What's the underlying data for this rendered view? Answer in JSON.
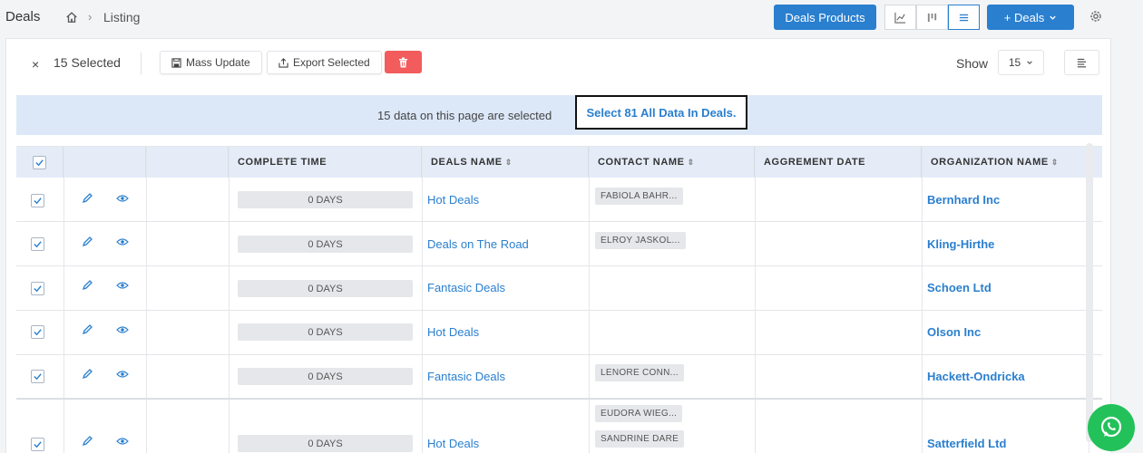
{
  "breadcrumb": {
    "title": "Deals",
    "separator": "›",
    "current": "Listing"
  },
  "header": {
    "products_button": "Deals Products",
    "add_button": "+ Deals"
  },
  "selection": {
    "close": "×",
    "count_label": "15 Selected",
    "mass_update": "Mass Update",
    "export_selected": "Export Selected",
    "show_label": "Show",
    "page_size": "15"
  },
  "banner": {
    "text": "15 data on this page are selected",
    "link": "Select 81 All Data In Deals."
  },
  "table": {
    "columns": [
      "COMPLETE TIME",
      "DEALS NAME",
      "CONTACT NAME",
      "AGGREMENT DATE",
      "ORGANIZATION NAME"
    ],
    "rows": [
      {
        "complete_time": "0 DAYS",
        "deal": "Hot Deals",
        "contacts": [
          "FABIOLA BAHR..."
        ],
        "agreement_date": "",
        "organization": "Bernhard Inc"
      },
      {
        "complete_time": "0 DAYS",
        "deal": "Deals on The Road",
        "contacts": [
          "ELROY JASKOL..."
        ],
        "agreement_date": "",
        "organization": "Kling-Hirthe"
      },
      {
        "complete_time": "0 DAYS",
        "deal": "Fantasic Deals",
        "contacts": [],
        "agreement_date": "",
        "organization": "Schoen Ltd"
      },
      {
        "complete_time": "0 DAYS",
        "deal": "Hot Deals",
        "contacts": [],
        "agreement_date": "",
        "organization": "Olson Inc"
      },
      {
        "complete_time": "0 DAYS",
        "deal": "Fantasic Deals",
        "contacts": [
          "LENORE CONN..."
        ],
        "agreement_date": "",
        "organization": "Hackett-Ondricka"
      },
      {
        "complete_time": "0 DAYS",
        "deal": "Hot Deals",
        "contacts": [
          "EUDORA WIEG...",
          "SANDRINE DARE"
        ],
        "agreement_date": "",
        "organization": "Satterfield Ltd"
      }
    ]
  },
  "colors": {
    "accent": "#2a7fcf",
    "danger": "#f25c5c",
    "banner": "#dce8f8",
    "whatsapp": "#23c15a"
  },
  "icons": [
    "home-icon",
    "chart-view-icon",
    "kanban-view-icon",
    "list-view-icon",
    "chevron-down-icon",
    "gear-icon",
    "save-icon",
    "export-icon",
    "trash-icon",
    "column-settings-icon",
    "check-icon",
    "edit-icon",
    "eye-icon",
    "sort-icon",
    "whatsapp-icon"
  ]
}
